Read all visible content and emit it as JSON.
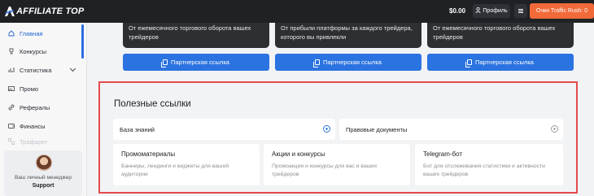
{
  "header": {
    "logo_text": "AFFILIATE TOP",
    "balance": "$0.00",
    "profile_label": "Профиль",
    "rush_label": "Очки Traffic Rush: 0"
  },
  "sidebar": {
    "items": [
      {
        "label": "Главная",
        "icon": "home-icon"
      },
      {
        "label": "Конкурсы",
        "icon": "trophy-icon"
      },
      {
        "label": "Статистика",
        "icon": "chart-icon"
      },
      {
        "label": "Промо",
        "icon": "image-icon"
      },
      {
        "label": "Рефералы",
        "icon": "link-icon"
      },
      {
        "label": "Финансы",
        "icon": "wallet-icon"
      },
      {
        "label": "Трафарет",
        "icon": "grid-icon"
      }
    ],
    "manager": {
      "label": "Ваш личный менеджер",
      "name": "Support"
    }
  },
  "top_cards": [
    {
      "text": "От ежемесячного торгового оборота вашех трейдеров",
      "button": "Партнерская ссылка"
    },
    {
      "text": "От прибыли платформы за каждого трейдера, которого вы привлекли",
      "button": "Партнерская ссылка"
    },
    {
      "text": "От ежемесячного торгового оборота вашех трейдеров",
      "button": "Партнерская ссылка"
    }
  ],
  "useful_links": {
    "title": "Полезные ссылки",
    "accordions": [
      {
        "label": "База знаний"
      },
      {
        "label": "Правовые документы"
      }
    ],
    "cards": [
      {
        "title": "Промоматериалы",
        "desc": "Баннеры, лендинги и виджеты для вашей аудитории"
      },
      {
        "title": "Акции и конкурсы",
        "desc": "Промоакции и конкурсы для вас и ваших трейдеров"
      },
      {
        "title": "Telegram-бот",
        "desc": "Бот для отслеживания статистики и активности ваших трейдеров"
      }
    ]
  },
  "colors": {
    "accent": "#2b73e0",
    "rush": "#f26a3a",
    "highlight": "#e44b4b",
    "header_bg": "#1f2125"
  }
}
